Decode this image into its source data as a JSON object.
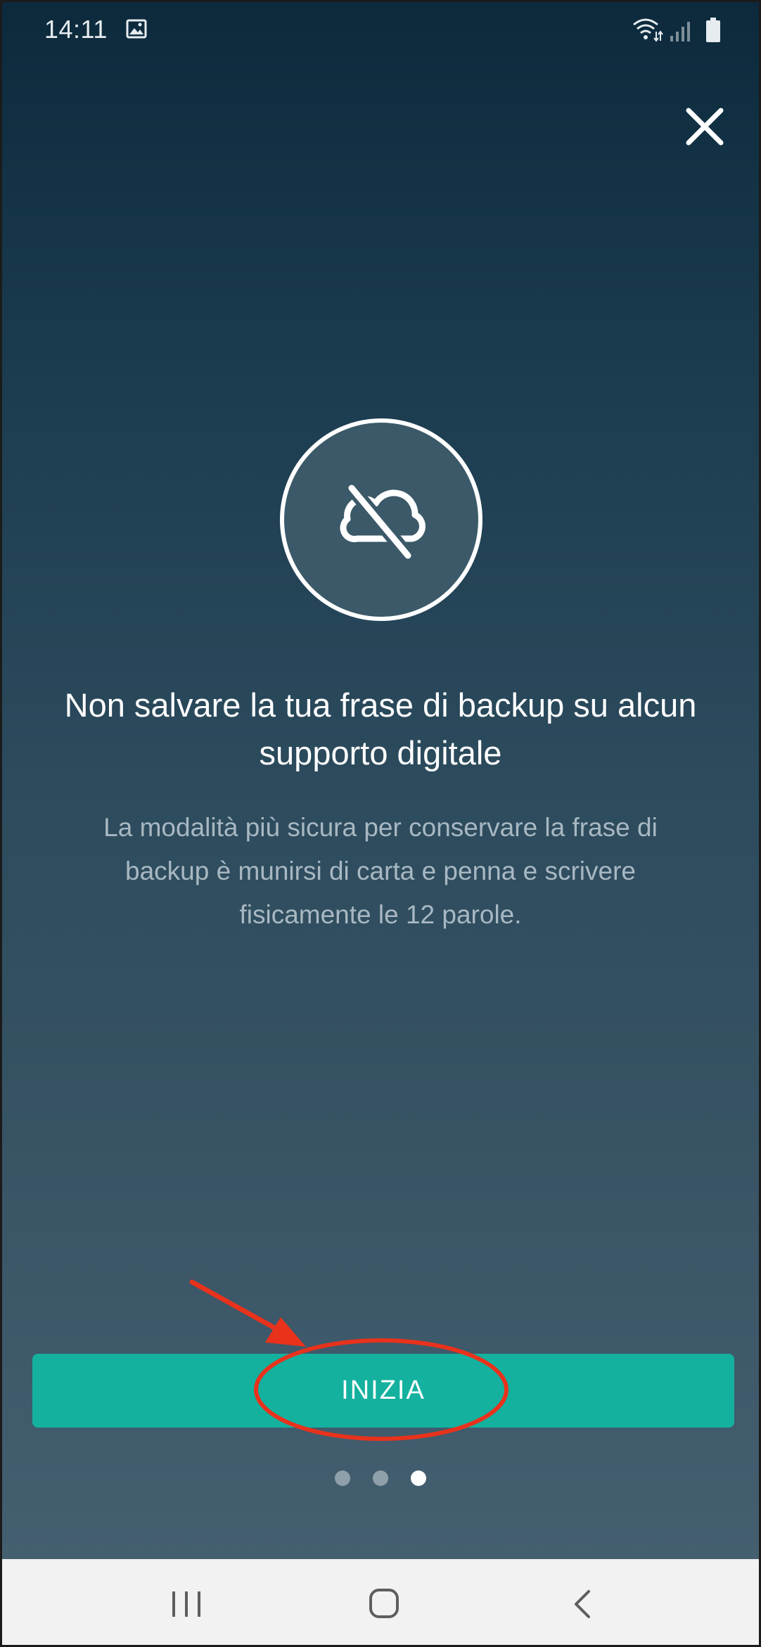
{
  "status_bar": {
    "time": "14:11",
    "icons": [
      "gallery-icon",
      "wifi-icon",
      "signal-icon",
      "battery-icon"
    ]
  },
  "header": {
    "close_icon": "close-icon"
  },
  "content": {
    "illustration_icon": "cloud-off-icon",
    "title": "Non salvare la tua frase di backup su alcun supporto digitale",
    "description": "La modalità più sicura per conservare la frase di backup è munirsi di carta e penna e scrivere fisicamente le 12 parole."
  },
  "cta": {
    "start_label": "INIZIA"
  },
  "pager": {
    "pages": 3,
    "active_page": 3
  },
  "nav_bar": {
    "icons": [
      "recents-icon",
      "home-icon",
      "back-icon"
    ]
  },
  "colors": {
    "gradient_top": "#0c2a3c",
    "gradient_bottom": "#445f70",
    "accent": "#14b19f",
    "annotation": "#e8321c"
  }
}
